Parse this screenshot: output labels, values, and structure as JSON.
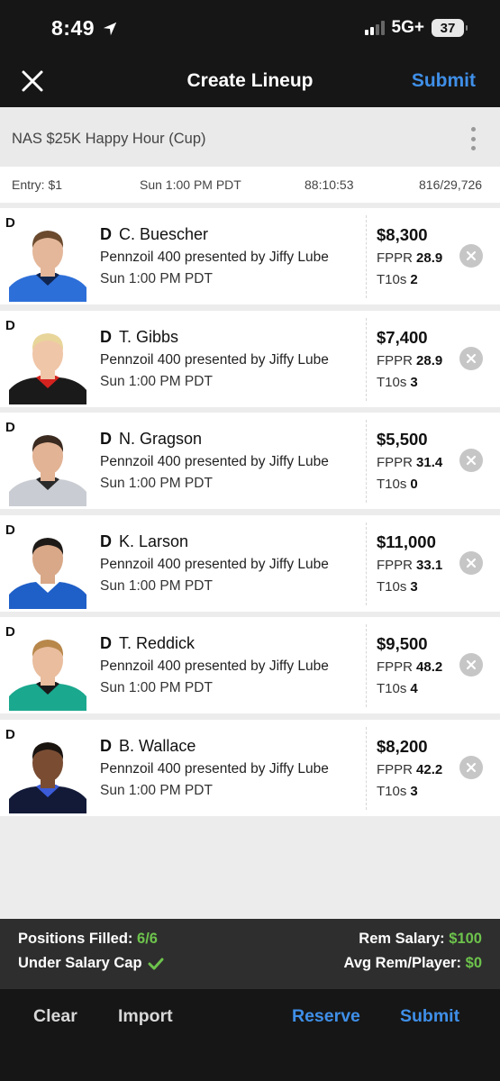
{
  "status": {
    "time": "8:49",
    "network": "5G+",
    "battery": "37",
    "icons": [
      "location-arrow-icon",
      "signal-icon",
      "battery-icon"
    ]
  },
  "nav": {
    "title": "Create Lineup",
    "submit_label": "Submit",
    "accent": "#3f8fe8"
  },
  "contest": {
    "name": "NAS $25K Happy Hour (Cup)",
    "entry": "Entry: $1",
    "start": "Sun 1:00 PM PDT",
    "countdown": "88:10:53",
    "entries": "816/29,726"
  },
  "lineup": [
    {
      "pos": "D",
      "name": "C. Buescher",
      "race": "Pennzoil 400 presented by Jiffy Lube",
      "time": "Sun 1:00 PM PDT",
      "salary": "$8,300",
      "fppr_label": "FPPR",
      "fppr": "28.9",
      "t10_label": "T10s",
      "t10": "2",
      "suit": "#2d6fd8",
      "suit2": "#10254f",
      "hair": "#6b4a2e",
      "skin": "#e4b79a"
    },
    {
      "pos": "D",
      "name": "T. Gibbs",
      "race": "Pennzoil 400 presented by Jiffy Lube",
      "time": "Sun 1:00 PM PDT",
      "salary": "$7,400",
      "fppr_label": "FPPR",
      "fppr": "28.9",
      "t10_label": "T10s",
      "t10": "3",
      "suit": "#1a1a1a",
      "suit2": "#d4231f",
      "hair": "#e8d59a",
      "skin": "#f0c6a8"
    },
    {
      "pos": "D",
      "name": "N. Gragson",
      "race": "Pennzoil 400 presented by Jiffy Lube",
      "time": "Sun 1:00 PM PDT",
      "salary": "$5,500",
      "fppr_label": "FPPR",
      "fppr": "31.4",
      "t10_label": "T10s",
      "t10": "0",
      "suit": "#c9ccd2",
      "suit2": "#2a2a2a",
      "hair": "#3a2a20",
      "skin": "#e2b394"
    },
    {
      "pos": "D",
      "name": "K. Larson",
      "race": "Pennzoil 400 presented by Jiffy Lube",
      "time": "Sun 1:00 PM PDT",
      "salary": "$11,000",
      "fppr_label": "FPPR",
      "fppr": "33.1",
      "t10_label": "T10s",
      "t10": "3",
      "suit": "#1f5fc8",
      "suit2": "#ffffff",
      "hair": "#1e1a18",
      "skin": "#d8a888"
    },
    {
      "pos": "D",
      "name": "T. Reddick",
      "race": "Pennzoil 400 presented by Jiffy Lube",
      "time": "Sun 1:00 PM PDT",
      "salary": "$9,500",
      "fppr_label": "FPPR",
      "fppr": "48.2",
      "t10_label": "T10s",
      "t10": "4",
      "suit": "#1aa88e",
      "suit2": "#1a1a1a",
      "hair": "#b8874a",
      "skin": "#e9bd9e"
    },
    {
      "pos": "D",
      "name": "B. Wallace",
      "race": "Pennzoil 400 presented by Jiffy Lube",
      "time": "Sun 1:00 PM PDT",
      "salary": "$8,200",
      "fppr_label": "FPPR",
      "fppr": "42.2",
      "t10_label": "T10s",
      "t10": "3",
      "suit": "#121a38",
      "suit2": "#3b5bd8",
      "hair": "#1a1411",
      "skin": "#7a4d33"
    }
  ],
  "summary": {
    "positions_label": "Positions Filled:",
    "positions_value": "6/6",
    "cap_label": "Under Salary Cap",
    "rem_salary_label": "Rem Salary:",
    "rem_salary_value": "$100",
    "avg_rem_label": "Avg Rem/Player:",
    "avg_rem_value": "$0",
    "positive_color": "#6dc34c"
  },
  "bottom": {
    "clear": "Clear",
    "import": "Import",
    "reserve": "Reserve",
    "submit": "Submit"
  }
}
